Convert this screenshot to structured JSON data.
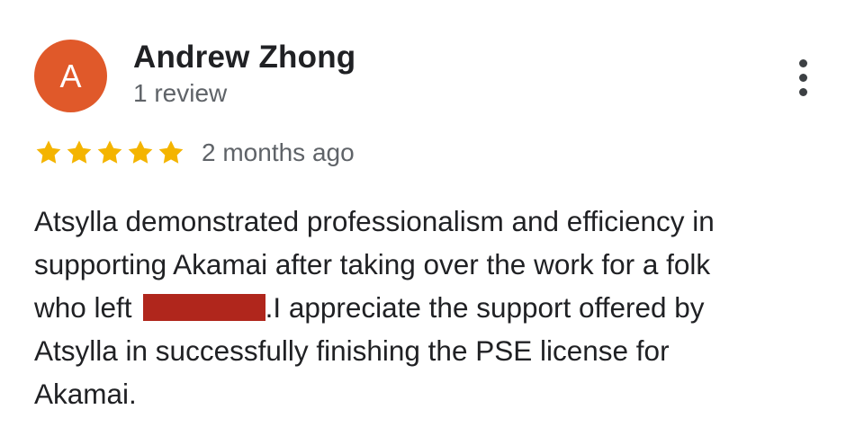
{
  "reviewer": {
    "avatar_letter": "A",
    "avatar_color": "#e0592a",
    "name": "Andrew Zhong",
    "review_count": "1 review"
  },
  "menu": {
    "icon": "more-vert-icon"
  },
  "rating": {
    "stars": 5,
    "max_stars": 5,
    "star_color": "#f4b400",
    "time_ago": "2 months ago"
  },
  "review": {
    "line1": "Atsylla demonstrated professionalism and efficiency in",
    "line2": "supporting Akamai after taking over the work for a folk",
    "line3_before": "who left",
    "line3_after": ".I appreciate the support offered by",
    "line4": "Atsylla in successfully finishing the PSE license for",
    "line5": "Akamai.",
    "redaction_color": "#b0261c"
  }
}
